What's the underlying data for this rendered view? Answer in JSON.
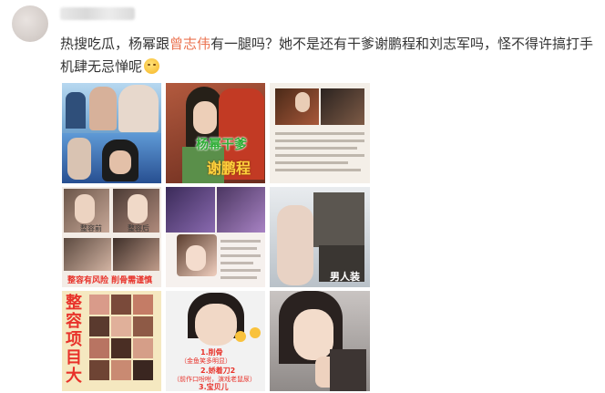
{
  "post": {
    "text_part1": "热搜吃瓜，杨幂跟",
    "mention": "曾志伟",
    "text_part2": "有一腿吗？她不是还有干爹谢鹏程和刘志军吗，怪不得许搞打手机肆无忌惮呢",
    "emoji": "smirk-emoji"
  },
  "images": [
    {
      "id": "img1",
      "labels": []
    },
    {
      "id": "img2",
      "labels": [
        "杨幂干爹",
        "谢鹏程"
      ]
    },
    {
      "id": "img3",
      "labels": []
    },
    {
      "id": "img4",
      "labels": [
        "整容前",
        "整容后",
        "整容后",
        "整容有风险 削骨需谨慎"
      ]
    },
    {
      "id": "img5",
      "labels": []
    },
    {
      "id": "img6",
      "labels": [
        "男人装"
      ]
    },
    {
      "id": "img7",
      "labels": [
        "整容项目大"
      ]
    },
    {
      "id": "img8",
      "labels": [
        "1.削骨",
        "（金鱼笑多明显）",
        "2.娇着刀2",
        "（前作口吩咐，演戏老鼠尿）",
        "3.宝贝儿"
      ]
    },
    {
      "id": "img9",
      "labels": []
    }
  ],
  "colors": {
    "mention": "#eb7350",
    "text": "#333333",
    "caption_red": "#e8322a",
    "caption_green": "#2fae36",
    "caption_yellow": "#ffd23d"
  }
}
